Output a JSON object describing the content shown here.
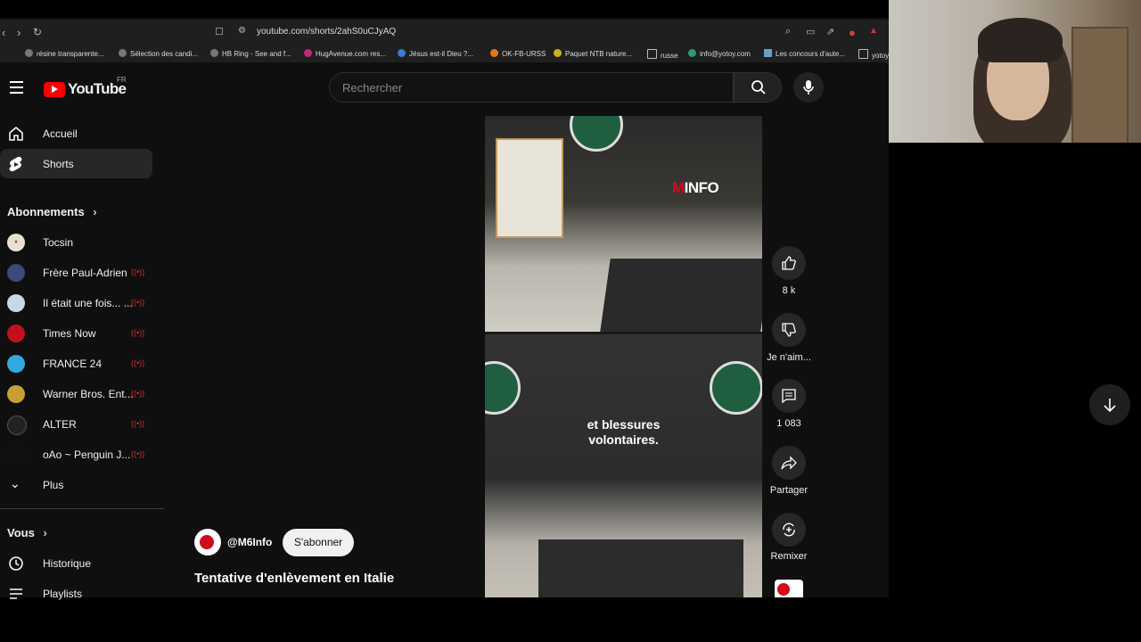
{
  "browser": {
    "url": "youtube.com/shorts/2ahS0uCJyAQ",
    "bookmarks": [
      "résine transparente...",
      "Sélection des candi...",
      "HB Ring - See and f...",
      "HugAvenue.com res...",
      "Jésus est-il Dieu ?...",
      "OK-FB-URSS",
      "Paquet NTB nature...",
      "russe",
      "info@yotoy.com",
      "Les concours d'aute...",
      "yotoy"
    ]
  },
  "youtube": {
    "logo_text": "YouTube",
    "region": "FR",
    "search_placeholder": "Rechercher"
  },
  "sidebar": {
    "home": "Accueil",
    "shorts": "Shorts",
    "subscriptions_header": "Abonnements",
    "subscriptions": [
      {
        "name": "Tocsin",
        "live": false,
        "color": "#e8e0d0"
      },
      {
        "name": "Frère Paul-Adrien",
        "live": true,
        "color": "#3a4a7a"
      },
      {
        "name": "Il était une fois... ...",
        "live": true,
        "color": "#c8d8e8"
      },
      {
        "name": "Times Now",
        "live": true,
        "color": "#c01020"
      },
      {
        "name": "FRANCE 24",
        "live": true,
        "color": "#33aadd"
      },
      {
        "name": "Warner Bros. Ent...",
        "live": true,
        "color": "#c8a030"
      },
      {
        "name": "ALTER",
        "live": true,
        "color": "#222222"
      },
      {
        "name": "oAo ~ Penguin J...",
        "live": true,
        "color": "#111111"
      }
    ],
    "more": "Plus",
    "you_header": "Vous",
    "history": "Historique",
    "playlists": "Playlists"
  },
  "short": {
    "watermark": "INFO",
    "caption_line1": "et blessures",
    "caption_line2": "volontaires.",
    "channel_handle": "@M6Info",
    "subscribe_label": "S'abonner",
    "title": "Tentative d'enlèvement en Italie"
  },
  "actions": {
    "likes": "8 k",
    "dislike_label": "Je n'aim...",
    "comments": "1 083",
    "share_label": "Partager",
    "remix_label": "Remixer"
  }
}
